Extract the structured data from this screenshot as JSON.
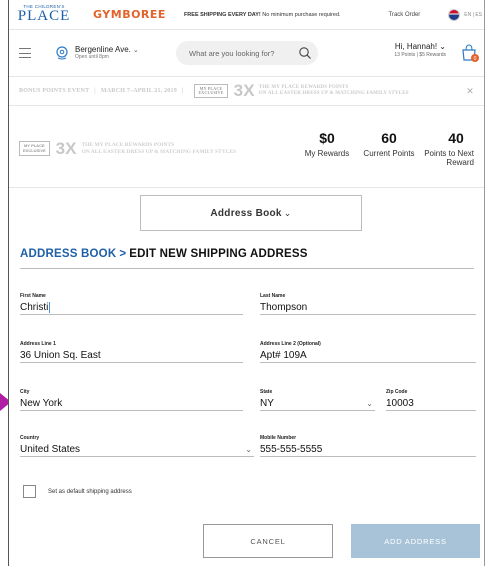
{
  "topbar": {
    "brand_small": "THE CHILDREN'S",
    "brand_place": "PLACE",
    "brand_gymboree": "GYMBOREE",
    "shipping_bold": "FREE SHIPPING EVERY DAY!",
    "shipping_rest": "No minimum purchase required.",
    "track_order": "Track Order",
    "language": "EN | ES"
  },
  "navbar": {
    "store_name": "Bergenline Ave.",
    "store_hours": "Open until 8pm",
    "search_placeholder": "What are you looking for?",
    "greeting": "Hi, Hannah!",
    "points_summary": "13 Points  |  $5 Rewards",
    "bag_count": "0"
  },
  "promo": {
    "event": "BONUS POINTS EVENT",
    "dates": "MARCH 7–APRIL 21, 2019",
    "exclusive_line1": "MY PLACE",
    "exclusive_line2": "EXCLUSIVE",
    "multiplier": "3X",
    "line1": "THE MY PLACE REWARDS POINTS",
    "line2": "ON ALL EASTER DRESS UP & MATCHING FAMILY STYLES"
  },
  "rewards": {
    "multiplier": "3X",
    "line1": "THE MY PLACE REWARDS POINTS",
    "line2": "ON ALL EASTER DRESS UP & MATCHING FAMILY STYLES",
    "stats": [
      {
        "value": "$0",
        "label": "My Rewards"
      },
      {
        "value": "60",
        "label": "Current Points"
      },
      {
        "value": "40",
        "label": "Points to Next Reward"
      }
    ]
  },
  "address_book_dropdown": "Address Book",
  "heading": {
    "link": "ADDRESS BOOK",
    "separator": ">",
    "current": "EDIT NEW SHIPPING ADDRESS"
  },
  "form": {
    "first_name": {
      "label": "First Name",
      "value": "Christi"
    },
    "last_name": {
      "label": "Last Name",
      "value": "Thompson"
    },
    "address1": {
      "label": "Address Line 1",
      "value": "36 Union Sq. East"
    },
    "address2": {
      "label": "Address Line 2 (Optional)",
      "value": "Apt# 109A"
    },
    "city": {
      "label": "City",
      "value": "New York"
    },
    "state": {
      "label": "State",
      "value": "NY"
    },
    "zip": {
      "label": "Zip Code",
      "value": "10003"
    },
    "country": {
      "label": "Country",
      "value": "United States"
    },
    "mobile": {
      "label": "Mobile Number",
      "value": "555-555-5555"
    },
    "default_checkbox_label": "Set as default shipping address"
  },
  "buttons": {
    "cancel": "CANCEL",
    "add_address": "ADD ADDRESS"
  },
  "colors": {
    "brand_blue": "#1b5ea8",
    "gymboree_orange": "#e4622c",
    "heading_link": "#1f5fa8",
    "add_button": "#a8c3d8",
    "pointer": "#b01fa3"
  }
}
